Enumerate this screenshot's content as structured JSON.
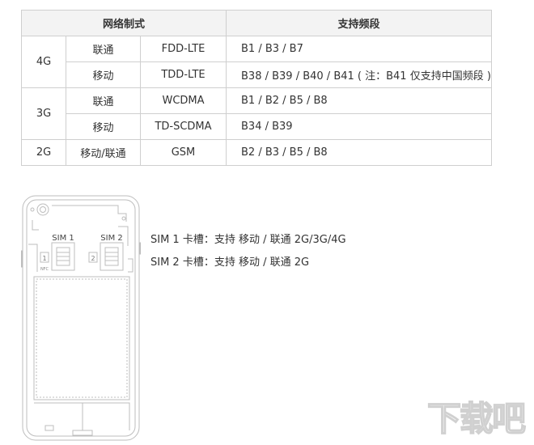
{
  "table": {
    "header": {
      "network": "网络制式",
      "bands": "支持频段"
    },
    "groups": [
      {
        "gen": "4G",
        "rows": [
          {
            "carrier": "联通",
            "standard": "FDD-LTE",
            "bands": "B1 / B3 / B7"
          },
          {
            "carrier": "移动",
            "standard": "TDD-LTE",
            "bands": "B38 / B39 / B40 / B41 ( 注：B41 仅支持中国频段 )"
          }
        ]
      },
      {
        "gen": "3G",
        "rows": [
          {
            "carrier": "联通",
            "standard": "WCDMA",
            "bands": "B1 / B2 / B5 / B8"
          },
          {
            "carrier": "移动",
            "standard": "TD-SCDMA",
            "bands": "B34 / B39"
          }
        ]
      },
      {
        "gen": "2G",
        "rows": [
          {
            "carrier": "移动/联通",
            "standard": "GSM",
            "bands": "B2 / B3 / B5 / B8"
          }
        ]
      }
    ]
  },
  "diagram": {
    "sim1_label": "SIM 1",
    "sim2_label": "SIM 2",
    "slot1_number": "1",
    "slot2_number": "2",
    "nfc_label": "NFC"
  },
  "notes": {
    "sim1": "SIM 1 卡槽：支持 移动 / 联通 2G/3G/4G",
    "sim2": "SIM 2 卡槽：支持 移动 / 联通 2G"
  },
  "watermark": "下载吧",
  "colors": {
    "border": "#cfcfcf",
    "header_bg": "#f3f3f3",
    "line_art": "#bdbdbd",
    "watermark": "#d0d0d0"
  }
}
